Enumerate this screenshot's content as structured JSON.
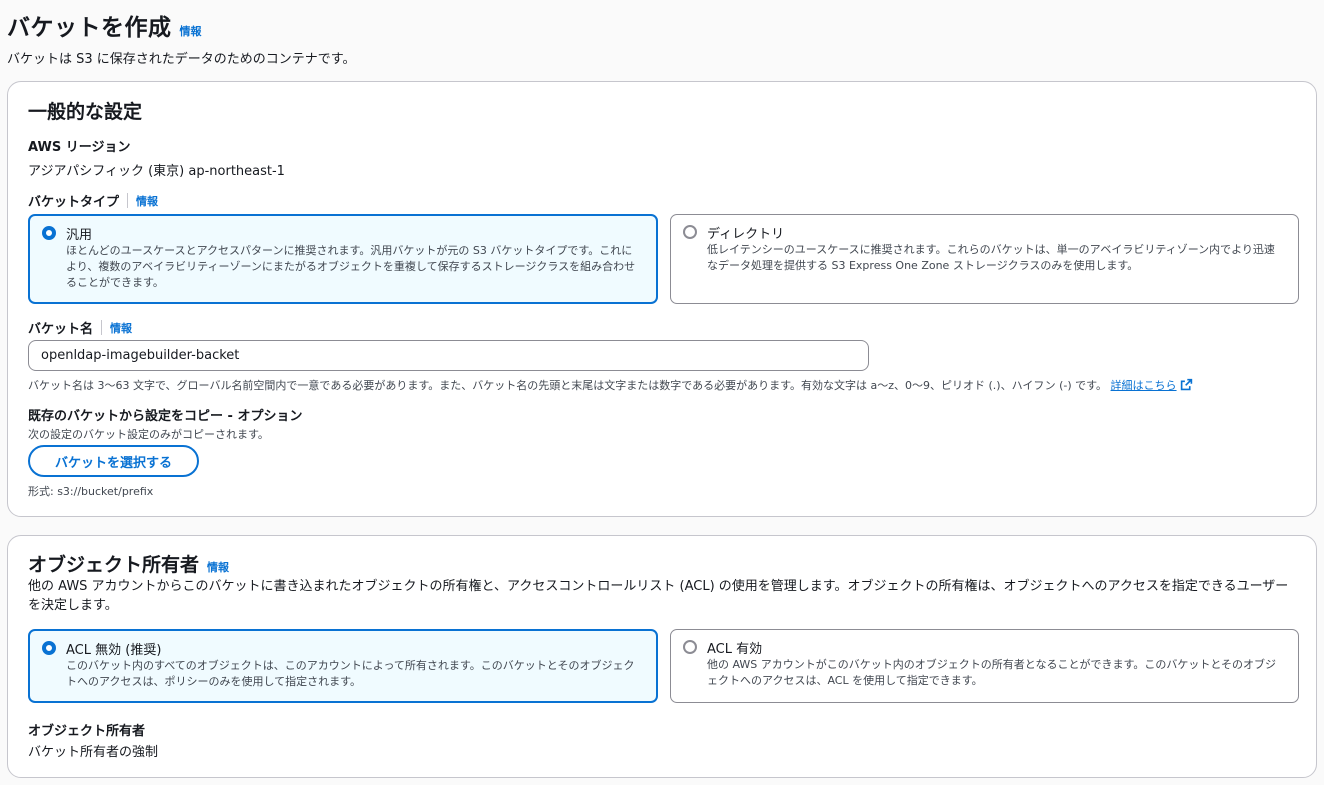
{
  "header": {
    "title": "バケットを作成",
    "info": "情報",
    "description": "バケットは S3 に保存されたデータのためのコンテナです。"
  },
  "general": {
    "title": "一般的な設定",
    "region_label": "AWS リージョン",
    "region_value": "アジアパシフィック (東京) ap-northeast-1",
    "bucket_type_label": "バケットタイプ",
    "bucket_type_info": "情報",
    "bucket_types": [
      {
        "title": "汎用",
        "description": "ほとんどのユースケースとアクセスパターンに推奨されます。汎用バケットが元の S3 バケットタイプです。これにより、複数のアベイラビリティーゾーンにまたがるオブジェクトを重複して保存するストレージクラスを組み合わせることができます。",
        "selected": true
      },
      {
        "title": "ディレクトリ",
        "description": "低レイテンシーのユースケースに推奨されます。これらのバケットは、単一のアベイラビリティゾーン内でより迅速なデータ処理を提供する S3 Express One Zone ストレージクラスのみを使用します。",
        "selected": false
      }
    ],
    "bucket_name_label": "バケット名",
    "bucket_name_info": "情報",
    "bucket_name_value": "openldap-imagebuilder-backet",
    "bucket_name_hint": "バケット名は 3～63 文字で、グローバル名前空間内で一意である必要があります。また、バケット名の先頭と末尾は文字または数字である必要があります。有効な文字は a～z、0～9、ピリオド (.)、ハイフン (-) です。",
    "bucket_name_link": "詳細はこちら",
    "copy_label": "既存のバケットから設定をコピー - オプション",
    "copy_desc": "次の設定のバケット設定のみがコピーされます。",
    "copy_button": "バケットを選択する",
    "copy_format": "形式: s3://bucket/prefix"
  },
  "ownership": {
    "title": "オブジェクト所有者",
    "info": "情報",
    "description": "他の AWS アカウントからこのバケットに書き込まれたオブジェクトの所有権と、アクセスコントロールリスト (ACL) の使用を管理します。オブジェクトの所有権は、オブジェクトへのアクセスを指定できるユーザーを決定します。",
    "options": [
      {
        "title": "ACL 無効 (推奨)",
        "description": "このバケット内のすべてのオブジェクトは、このアカウントによって所有されます。このバケットとそのオブジェクトへのアクセスは、ポリシーのみを使用して指定されます。",
        "selected": true
      },
      {
        "title": "ACL 有効",
        "description": "他の AWS アカウントがこのバケット内のオブジェクトの所有者となることができます。このバケットとそのオブジェクトへのアクセスは、ACL を使用して指定できます。",
        "selected": false
      }
    ],
    "owner_label": "オブジェクト所有者",
    "owner_value": "バケット所有者の強制"
  },
  "colors": {
    "accent": "#0972d3",
    "selected_bg": "#f0fbff",
    "border": "#8c8c94",
    "text": "#16191f"
  },
  "icons": {
    "external_link": "external-link-icon"
  }
}
